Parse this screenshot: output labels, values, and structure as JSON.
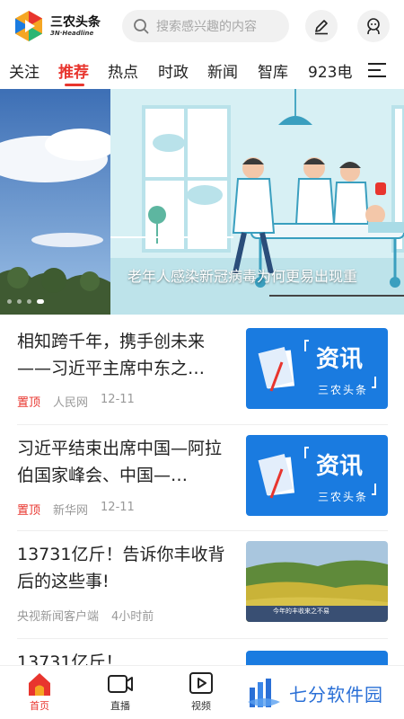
{
  "header": {
    "logo_title": "三农头条",
    "logo_subtitle": "3N·Headline",
    "search_placeholder": "搜索感兴趣的内容"
  },
  "tabs": [
    {
      "label": "关注",
      "active": false
    },
    {
      "label": "推荐",
      "active": true
    },
    {
      "label": "热点",
      "active": false
    },
    {
      "label": "时政",
      "active": false
    },
    {
      "label": "新闻",
      "active": false
    },
    {
      "label": "智库",
      "active": false
    },
    {
      "label": "923电",
      "active": false
    }
  ],
  "banner": {
    "caption": "老年人感染新冠病毒为何更易出现重",
    "slides": 4,
    "active_slide": 3
  },
  "feed": [
    {
      "title": "相知跨千年，携手创未来——习近平主席中东之…",
      "pinned_label": "置顶",
      "source": "人民网",
      "time": "12-11",
      "thumb_title": "资讯",
      "thumb_sub": "三农头条"
    },
    {
      "title": "习近平结束出席中国—阿拉伯国家峰会、中国—…",
      "pinned_label": "置顶",
      "source": "新华网",
      "time": "12-11",
      "thumb_title": "资讯",
      "thumb_sub": "三农头条"
    },
    {
      "title": "13731亿斤！告诉你丰收背后的这些事!",
      "pinned_label": "",
      "source": "央视新闻客户端",
      "time": "4小时前",
      "thumb_caption": "今年的丰收来之不易"
    },
    {
      "title": "13731亿斤！"
    }
  ],
  "bottom_nav": [
    {
      "label": "首页",
      "active": true,
      "icon": "home-icon"
    },
    {
      "label": "直播",
      "active": false,
      "icon": "video-camera-icon"
    },
    {
      "label": "视频",
      "active": false,
      "icon": "play-icon"
    }
  ],
  "watermark": {
    "text": "七分软件园"
  },
  "colors": {
    "accent": "#e8352e",
    "thumb_blue": "#1a7be0",
    "muted": "#999999"
  }
}
